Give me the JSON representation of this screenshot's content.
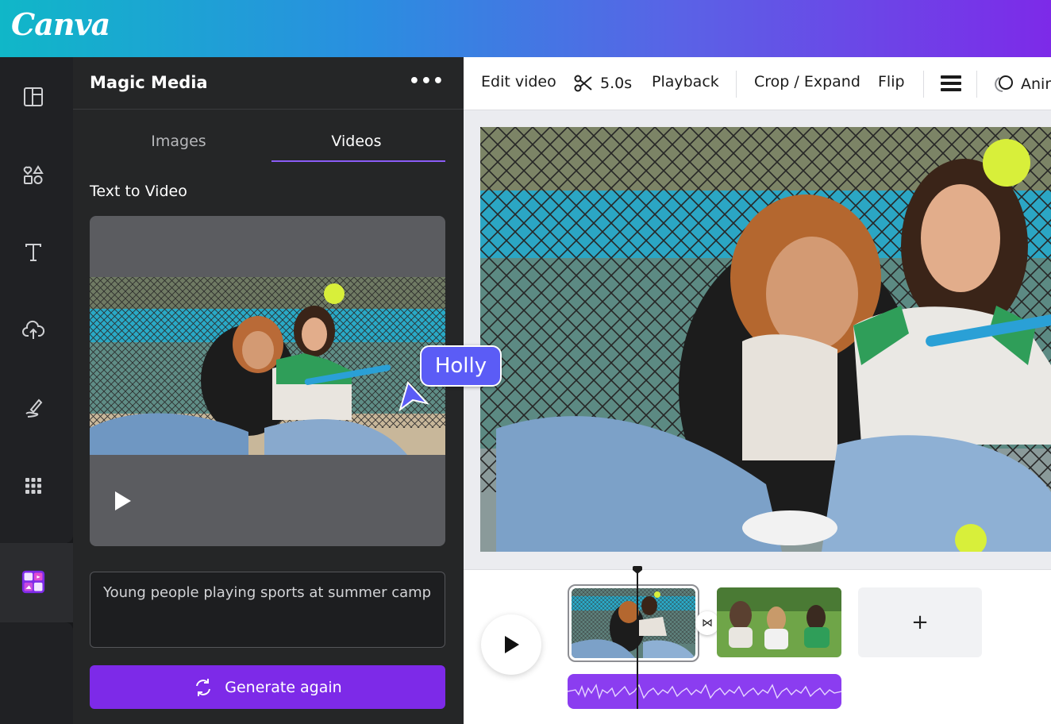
{
  "brand": {
    "logo_text": "Canva"
  },
  "rail": {
    "items": [
      {
        "name": "design-templates",
        "icon": "layout-icon"
      },
      {
        "name": "elements",
        "icon": "shapes-icon"
      },
      {
        "name": "text",
        "icon": "text-icon"
      },
      {
        "name": "uploads",
        "icon": "cloud-upload-icon"
      },
      {
        "name": "draw",
        "icon": "draw-icon"
      },
      {
        "name": "apps",
        "icon": "grid-icon"
      },
      {
        "name": "magic-media",
        "icon": "magic-media-icon",
        "active": true
      }
    ]
  },
  "panel": {
    "title": "Magic Media",
    "more_label": "•••",
    "tabs": [
      {
        "label": "Images",
        "active": false
      },
      {
        "label": "Videos",
        "active": true
      }
    ],
    "section_label": "Text to Video",
    "prompt_text": "Young people playing sports at summer camp",
    "generate_label": "Generate again"
  },
  "collaborator": {
    "name": "Holly",
    "color": "#5b5cf6"
  },
  "toolbar": {
    "edit_video": "Edit video",
    "duration": "5.0s",
    "playback": "Playback",
    "crop_expand": "Crop / Expand",
    "flip": "Flip",
    "animate": "Anim"
  },
  "timeline": {
    "add_clip": "+",
    "transition_symbol": "⋈"
  },
  "colors": {
    "accent": "#7d2ae8",
    "gradient_start": "#10b7c8",
    "gradient_end": "#7d2ae8"
  }
}
